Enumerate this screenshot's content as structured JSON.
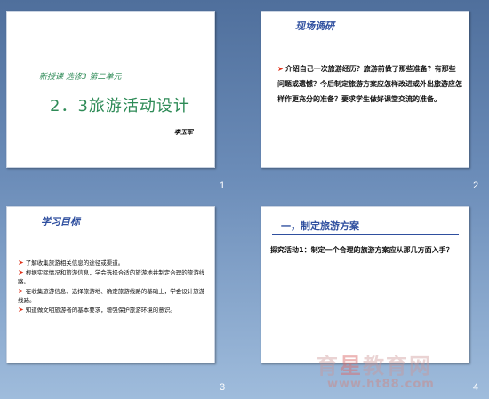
{
  "slides": [
    {
      "number": "1",
      "subtitle": "新授课  选修3  第二单元",
      "title": "2．3旅游活动设计",
      "author": "李玉军"
    },
    {
      "number": "2",
      "title": "现场调研",
      "body": "介绍自己一次旅游经历？旅游前做了那些准备？有那些问题或遗憾？今后制定旅游方案应怎样改进或外出旅游应怎样作更充分的准备？要求学生做好课堂交流的准备。"
    },
    {
      "number": "3",
      "title": "学习目标",
      "items": [
        "了解收集旅游相关信息的途径或渠道。",
        "根据实际情况和旅游信息，学会选择合适的旅游地并制定合理的旅游线路。",
        "在收集旅游信息、选择旅游地、确定旅游线路的基础上，学会设计旅游线路。",
        "知道做文明旅游者的基本要求，增强保护旅游环境的意识。"
      ]
    },
    {
      "number": "4",
      "title": "一，制定旅游方案",
      "body": "探究活动1：制定一个合理的旅游方案应从那几方面入手？"
    }
  ],
  "watermark": {
    "text_pre": "育",
    "text_star": "星",
    "text_post": "教育网",
    "url": "www.ht88.com"
  },
  "colors": {
    "title_green": "#2e8b57",
    "title_blue": "#2f4f9f",
    "bullet_red": "#e0341c"
  }
}
